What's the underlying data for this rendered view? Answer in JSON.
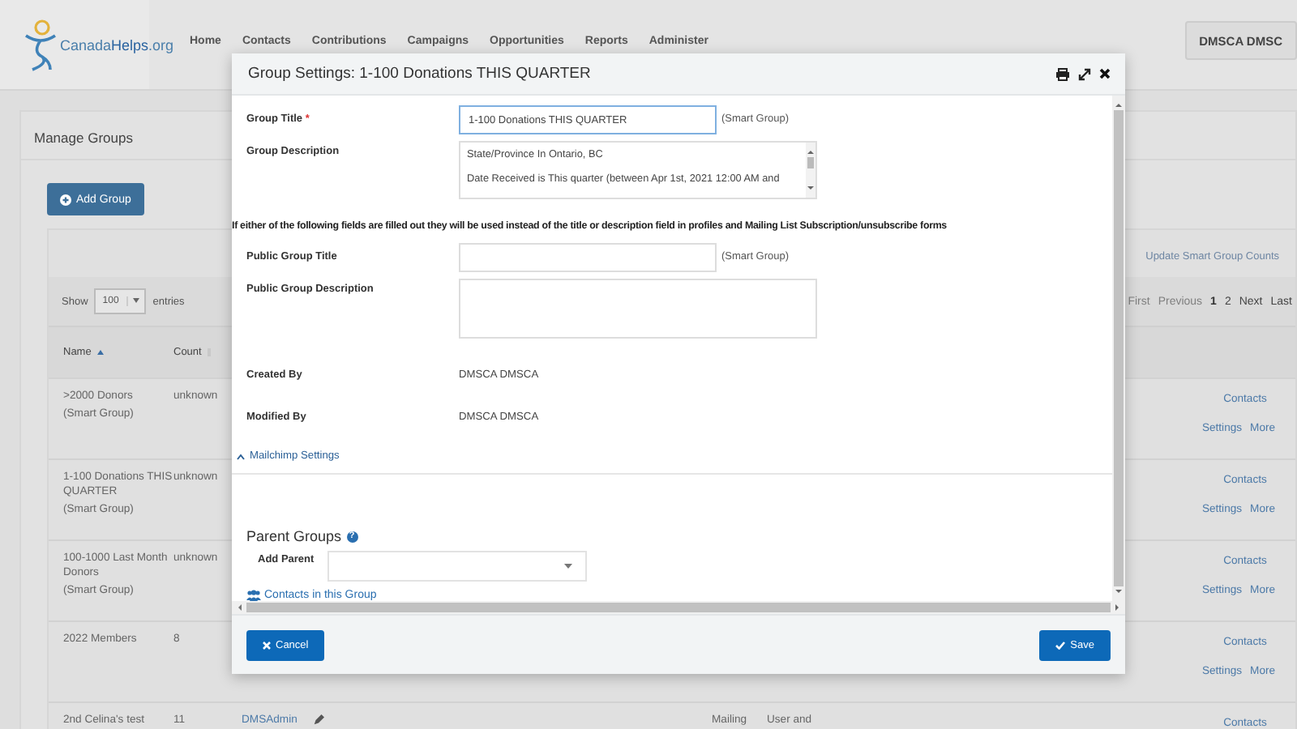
{
  "header": {
    "logo": {
      "brand_a": "Canada",
      "brand_b": "Helps",
      "suffix": ".org"
    },
    "nav": [
      "Home",
      "Contacts",
      "Contributions",
      "Campaigns",
      "Opportunities",
      "Reports",
      "Administer"
    ],
    "user_button": "DMSCA DMSC"
  },
  "page": {
    "title": "Manage Groups",
    "add_button": "Add Group",
    "update_link": "Update Smart Group Counts",
    "show_label": "Show",
    "page_size": "100",
    "entries_label": "entries",
    "pagination": [
      {
        "label": "First",
        "disabled": true,
        "selected": false
      },
      {
        "label": "Previous",
        "disabled": true,
        "selected": false
      },
      {
        "label": "1",
        "disabled": false,
        "selected": true
      },
      {
        "label": "2",
        "disabled": false,
        "selected": false
      },
      {
        "label": "Next",
        "disabled": false,
        "selected": false
      },
      {
        "label": "Last",
        "disabled": false,
        "selected": false
      }
    ],
    "columns": [
      {
        "label": "Name",
        "sorted": true
      },
      {
        "label": "Count",
        "sorted": false
      }
    ],
    "rows": [
      {
        "name": ">2000 Donors",
        "note": "(Smart Group)",
        "count": "unknown",
        "actions": [
          "Contacts",
          "Settings",
          "More"
        ]
      },
      {
        "name": "1-100 Donations THIS QUARTER",
        "note": "(Smart Group)",
        "count": "unknown",
        "actions": [
          "Contacts",
          "Settings",
          "More"
        ]
      },
      {
        "name": "100-1000 Last Month Donors",
        "note": "(Smart Group)",
        "count": "unknown",
        "actions": [
          "Contacts",
          "Settings",
          "More"
        ]
      },
      {
        "name": "2022 Members",
        "count": "8",
        "actions": [
          "Contacts",
          "Settings",
          "More"
        ]
      },
      {
        "name": "2nd Celina's test",
        "count": "11",
        "created_by": "DMSAdmin",
        "type": "Mailing",
        "visibility": "User and",
        "actions": [
          "Contacts"
        ]
      }
    ]
  },
  "dialog": {
    "title": "Group Settings: 1-100 Donations THIS QUARTER",
    "fields_top": [
      {
        "kind": "input",
        "label": "Group Title",
        "required_mark": "*",
        "value": "1-100 Donations THIS QUARTER",
        "suffix": "(Smart Group)"
      },
      {
        "kind": "textarea",
        "label": "Group Description",
        "lines": [
          "State/Province In Ontario, BC",
          "Date Received is This quarter (between Apr 1st, 2021 12:00 AM and"
        ]
      }
    ],
    "notice": "If either of the following fields are filled out they will be used instead of the title or description field in profiles and Mailing List Subscription/unsubscribe forms",
    "fields_bottom": [
      {
        "kind": "input",
        "label": "Public Group Title",
        "suffix": "(Smart Group)"
      },
      {
        "kind": "textarea",
        "label": "Public Group Description"
      },
      {
        "kind": "text",
        "label": "Created By",
        "value": "DMSCA DMSCA"
      },
      {
        "kind": "text",
        "label": "Modified By",
        "value": "DMSCA DMSCA"
      }
    ],
    "mailchimp": {
      "label": "Mailchimp Settings",
      "expanded": true
    },
    "parent_groups": {
      "heading": "Parent Groups",
      "help": "?",
      "add_label": "Add Parent"
    },
    "contacts_link": "Contacts in this Group",
    "cancel": "Cancel",
    "save": "Save"
  }
}
